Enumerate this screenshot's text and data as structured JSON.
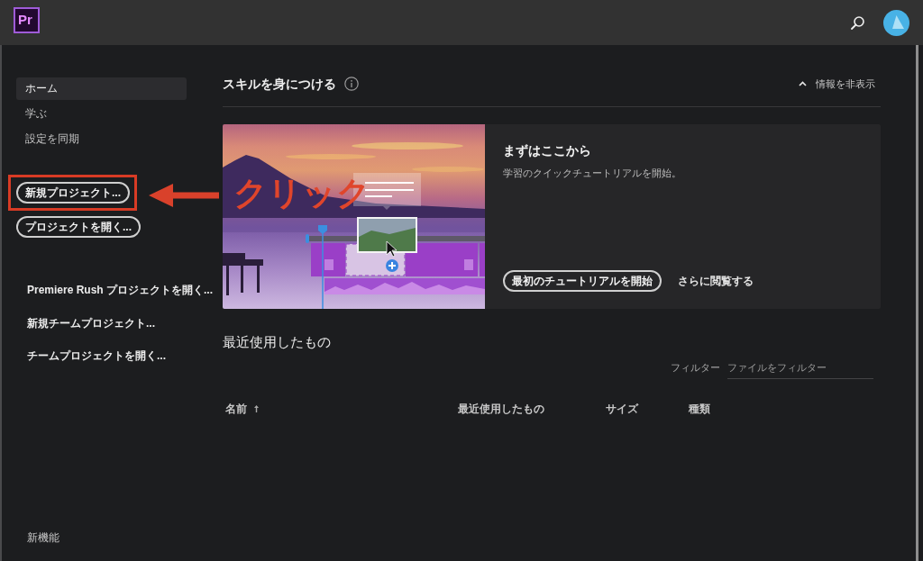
{
  "top_bar": {
    "logo": "Pr"
  },
  "sidebar": {
    "nav": [
      {
        "label": "ホーム",
        "selected": true
      },
      {
        "label": "学ぶ",
        "selected": false
      },
      {
        "label": "設定を同期",
        "selected": false
      }
    ],
    "buttons": [
      {
        "label": "新規プロジェクト...",
        "highlighted": true
      },
      {
        "label": "プロジェクトを開く...",
        "highlighted": false
      }
    ],
    "links": [
      "Premiere Rush プロジェクトを開く...",
      "新規チームプロジェクト...",
      "チームプロジェクトを開く..."
    ],
    "footer_link": "新機能"
  },
  "annotation": {
    "text": "クリック"
  },
  "skills": {
    "title": "スキルを身につける",
    "toggle": {
      "label": "情報を非表示",
      "expanded": true
    },
    "card": {
      "title": "まずはここから",
      "subtitle": "学習のクイックチュートリアルを開始。",
      "primary_button": "最初のチュートリアルを開始",
      "link": "さらに閲覧する"
    }
  },
  "recent": {
    "title": "最近使用したもの",
    "filter": {
      "label": "フィルター",
      "placeholder": "ファイルをフィルター"
    },
    "table": {
      "columns": [
        {
          "label": "名前",
          "sorted": true
        },
        {
          "label": "最近使用したもの",
          "sorted": false
        },
        {
          "label": "サイズ",
          "sorted": false
        },
        {
          "label": "種類",
          "sorted": false
        }
      ]
    }
  }
}
